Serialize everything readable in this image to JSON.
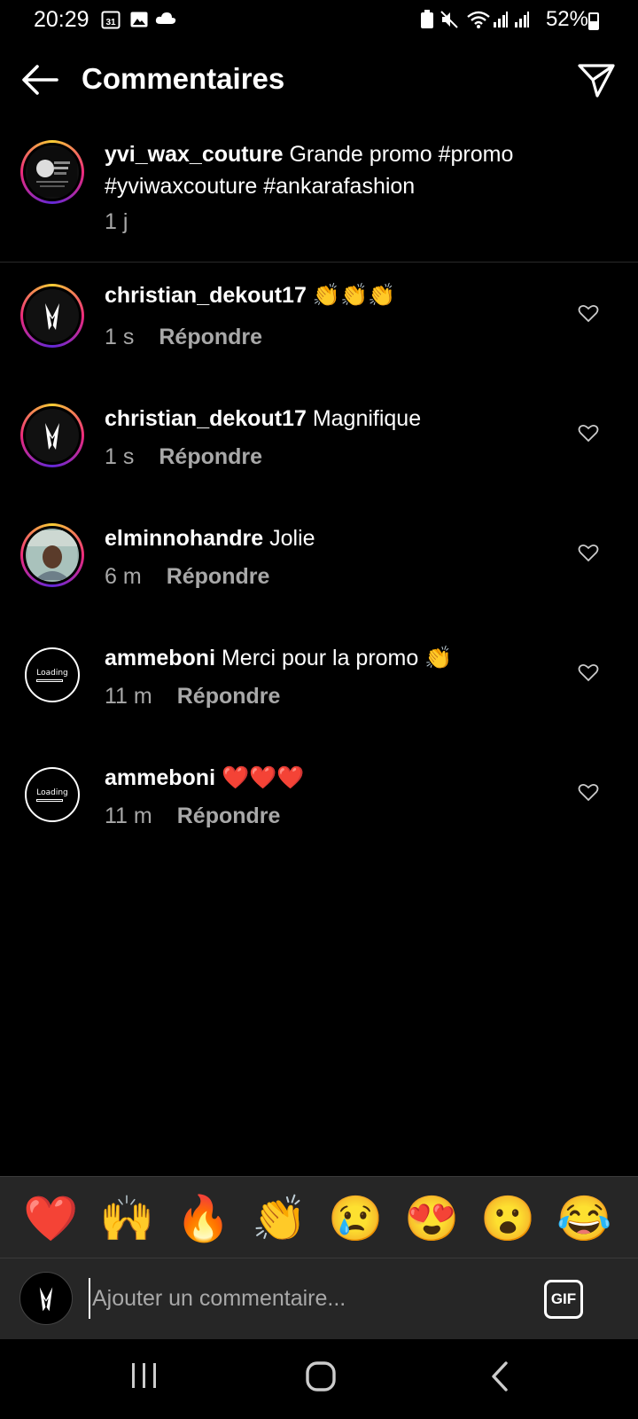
{
  "status_bar": {
    "time": "20:29",
    "calendar_badge": "31",
    "battery": "52%",
    "battery_level": 0.52
  },
  "header": {
    "title": "Commentaires"
  },
  "caption": {
    "username": "yvi_wax_couture",
    "text": "Grande promo #promo #yviwaxcouture #ankarafashion",
    "time": "1 j"
  },
  "comments": [
    {
      "username": "christian_dekout17",
      "text": "👏👏👏",
      "time": "1 s",
      "reply": "Répondre"
    },
    {
      "username": "christian_dekout17",
      "text": "Magnifique",
      "time": "1 s",
      "reply": "Répondre"
    },
    {
      "username": "elminnohandre",
      "text": "Jolie",
      "time": "6 m",
      "reply": "Répondre"
    },
    {
      "username": "ammeboni",
      "text": "Merci pour la promo 👏",
      "time": "11 m",
      "reply": "Répondre"
    },
    {
      "username": "ammeboni",
      "text": "❤️❤️❤️",
      "time": "11 m",
      "reply": "Répondre"
    }
  ],
  "avatar_text": {
    "loading": "Loading"
  },
  "emoji_bar": [
    "❤️",
    "🙌",
    "🔥",
    "👏",
    "😢",
    "😍",
    "😮",
    "😂"
  ],
  "input": {
    "placeholder": "Ajouter un commentaire...",
    "gif_label": "GIF"
  }
}
